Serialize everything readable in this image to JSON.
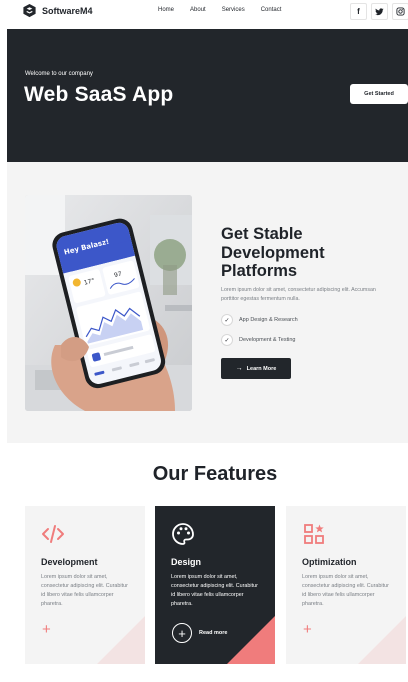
{
  "nav": {
    "brand": "SoftwareM4",
    "links": [
      "Home",
      "About",
      "Services",
      "Contact"
    ],
    "socials": [
      {
        "icon": "facebook-icon",
        "glyph": "f"
      },
      {
        "icon": "twitter-icon",
        "glyph": "t"
      },
      {
        "icon": "instagram-icon",
        "glyph": "◎"
      }
    ]
  },
  "hero": {
    "pretitle": "Welcome to our company",
    "title": "Web SaaS App",
    "button": "Get Started"
  },
  "about": {
    "title": "Get Stable Development Platforms",
    "text": "Lorem ipsum dolor sit amet, consectetur adipiscing elit. Accumsan porttitor egestas fermentum nulla.",
    "checks": [
      "App Design & Research",
      "Development & Testing"
    ],
    "button": "Learn More",
    "phone_greeting": "Hey Balasz!",
    "phone_temps": [
      "17°",
      "97"
    ]
  },
  "features": {
    "title": "Our Features",
    "cards": [
      {
        "title": "Development",
        "text": "Lorem ipsum dolor sit amet, consectetur adipiscing elit. Curabitur id libero vitae felis ullamcorper pharetra.",
        "icon": "code-icon"
      },
      {
        "title": "Design",
        "text": "Lorem ipsum dolor sit amet, consectetur adipiscing elit. Curabitur id libero vitae felis ullamcorper pharetra.",
        "icon": "palette-icon",
        "link": "Read more"
      },
      {
        "title": "Optimization",
        "text": "Lorem ipsum dolor sit amet, consectetur adipiscing elit. Curabitur id libero vitae felis ullamcorper pharetra.",
        "icon": "shapes-icon"
      }
    ]
  },
  "colors": {
    "dark": "#22262b",
    "accent": "#f07c7c",
    "light_bg": "#f4f4f4"
  }
}
